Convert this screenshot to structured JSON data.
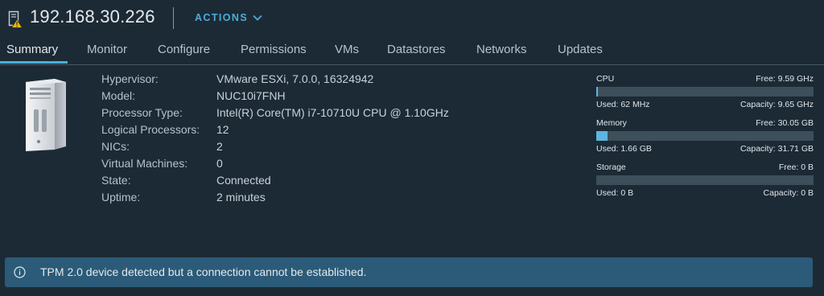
{
  "header": {
    "title": "192.168.30.226",
    "actions_label": "ACTIONS"
  },
  "tabs": [
    {
      "label": "Summary",
      "active": true
    },
    {
      "label": "Monitor"
    },
    {
      "label": "Configure"
    },
    {
      "label": "Permissions"
    },
    {
      "label": "VMs"
    },
    {
      "label": "Datastores"
    },
    {
      "label": "Networks"
    },
    {
      "label": "Updates"
    }
  ],
  "summary": {
    "properties": [
      {
        "label": "Hypervisor:",
        "value": "VMware ESXi, 7.0.0, 16324942"
      },
      {
        "label": "Model:",
        "value": "NUC10i7FNH"
      },
      {
        "label": "Processor Type:",
        "value": "Intel(R) Core(TM) i7-10710U CPU @ 1.10GHz"
      },
      {
        "label": "Logical Processors:",
        "value": "12"
      },
      {
        "label": "NICs:",
        "value": "2"
      },
      {
        "label": "Virtual Machines:",
        "value": "0"
      },
      {
        "label": "State:",
        "value": "Connected"
      },
      {
        "label": "Uptime:",
        "value": "2 minutes"
      }
    ]
  },
  "resources": {
    "cpu": {
      "name": "CPU",
      "free": "Free: 9.59 GHz",
      "used": "Used: 62 MHz",
      "capacity": "Capacity: 9.65 GHz",
      "used_fraction": 0.006
    },
    "memory": {
      "name": "Memory",
      "free": "Free: 30.05 GB",
      "used": "Used: 1.66 GB",
      "capacity": "Capacity: 31.71 GB",
      "used_fraction": 0.052
    },
    "storage": {
      "name": "Storage",
      "free": "Free: 0 B",
      "used": "Used: 0 B",
      "capacity": "Capacity: 0 B",
      "used_fraction": 0
    }
  },
  "alert": {
    "text": "TPM 2.0 device detected but a connection cannot be established."
  },
  "colors": {
    "background": "#1c2a35",
    "accent": "#49afd9",
    "alert_bg": "#2b5b78",
    "warning": "#f5b800"
  }
}
